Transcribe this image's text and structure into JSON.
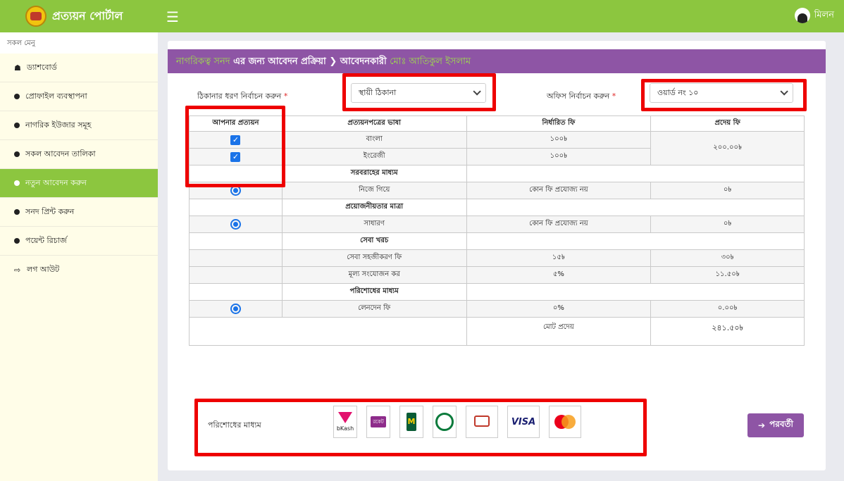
{
  "app": {
    "title": "প্রত্যয়ন পোর্টাল",
    "menu_icon": "☰",
    "user_name": "মিলন"
  },
  "sidebar": {
    "title": "সকল মেনু",
    "items": [
      {
        "label": "ড্যাশবোর্ড",
        "icon": "home-icon",
        "symbol": "☗"
      },
      {
        "label": "প্রোফাইল ব্যবস্থাপনা",
        "icon": "dot-icon"
      },
      {
        "label": "নাগরিক ইউজার সমূহ",
        "icon": "dot-icon"
      },
      {
        "label": "সকল আবেদন তালিকা",
        "icon": "dot-icon"
      },
      {
        "label": "নতুন আবেদন করুন",
        "icon": "dot-icon",
        "active": true
      },
      {
        "label": "সনদ প্রিন্ট করুন",
        "icon": "dot-icon"
      },
      {
        "label": "পয়েন্ট রিচার্জ",
        "icon": "dot-icon"
      },
      {
        "label": "লগ আউট",
        "icon": "logout-icon",
        "symbol": "⇨"
      }
    ]
  },
  "header": {
    "part1": "নাগরিকত্ব সনদ",
    "part2": " এর জন্য আবেদন প্রক্রিয়া ❯ আবেদনকারী ",
    "part3": "মোঃ আতিকুল ইসলাম"
  },
  "form": {
    "address_label": "ঠিকানার ধরণ নির্বাচন করুন",
    "address_value": "স্থায়ী ঠিকানা",
    "office_label": "অফিস নির্বাচন করুন",
    "office_value": "ওয়ার্ড নং ১০",
    "required_mark": "*"
  },
  "table": {
    "headers": [
      "আপনার প্রত্যয়ন",
      "প্রত্যয়নপত্রের ভাষা",
      "নির্ধারিত ফি",
      "প্রদেয় ফি"
    ],
    "languages": [
      {
        "name": "বাংলা",
        "fee": "১০০৳",
        "checked": true
      },
      {
        "name": "ইংরেজী",
        "fee": "১০০৳",
        "checked": true
      }
    ],
    "language_total": "২০০.০০৳",
    "delivery_title": "সরবরাহের মাধ্যম",
    "delivery": {
      "name": "নিজে গিয়ে",
      "fee": "কোন ফি প্রযোজ্য নয়",
      "payable": "০৳"
    },
    "urgency_title": "প্রয়োজনীয়তার মাত্রা",
    "urgency": {
      "name": "সাধারণ",
      "fee": "কোন ফি প্রযোজ্য নয়",
      "payable": "০৳"
    },
    "service_title": "সেবা খরচ",
    "service_rows": [
      {
        "name": "সেবা সহজীকরণ ফি",
        "fee": "১৫৳",
        "payable": "৩০৳"
      },
      {
        "name": "মূল্য সংযোজন কর",
        "fee": "৫%",
        "payable": "১১.৫০৳"
      }
    ],
    "payment_title": "পরিশোধের মাধ্যম",
    "payment_row": {
      "name": "লেনদেন ফি",
      "fee": "০%",
      "payable": "০.০০৳"
    },
    "total_label": "মোট প্রদেয়",
    "total_value": "২৪১.৫০৳"
  },
  "payment": {
    "label": "পরিশোধের মাধ্যম",
    "methods": [
      {
        "name": "bKash",
        "caption": "bKash"
      },
      {
        "name": "Rocket",
        "caption": "রকেট"
      },
      {
        "name": "mCash",
        "caption": "M"
      },
      {
        "name": "Islami Bank",
        "caption": ""
      },
      {
        "name": "Mutual Trust Bank",
        "caption": ""
      },
      {
        "name": "VISA",
        "caption": "VISA"
      },
      {
        "name": "MasterCard",
        "caption": "MasterCard"
      }
    ]
  },
  "next_button": {
    "label": "পরবর্তী",
    "arrow": "➔"
  },
  "colors": {
    "accent_green": "#8cc63f",
    "header_purple": "#8e55a5",
    "highlight_red": "#ee0000",
    "link_blue": "#1a73e8"
  }
}
